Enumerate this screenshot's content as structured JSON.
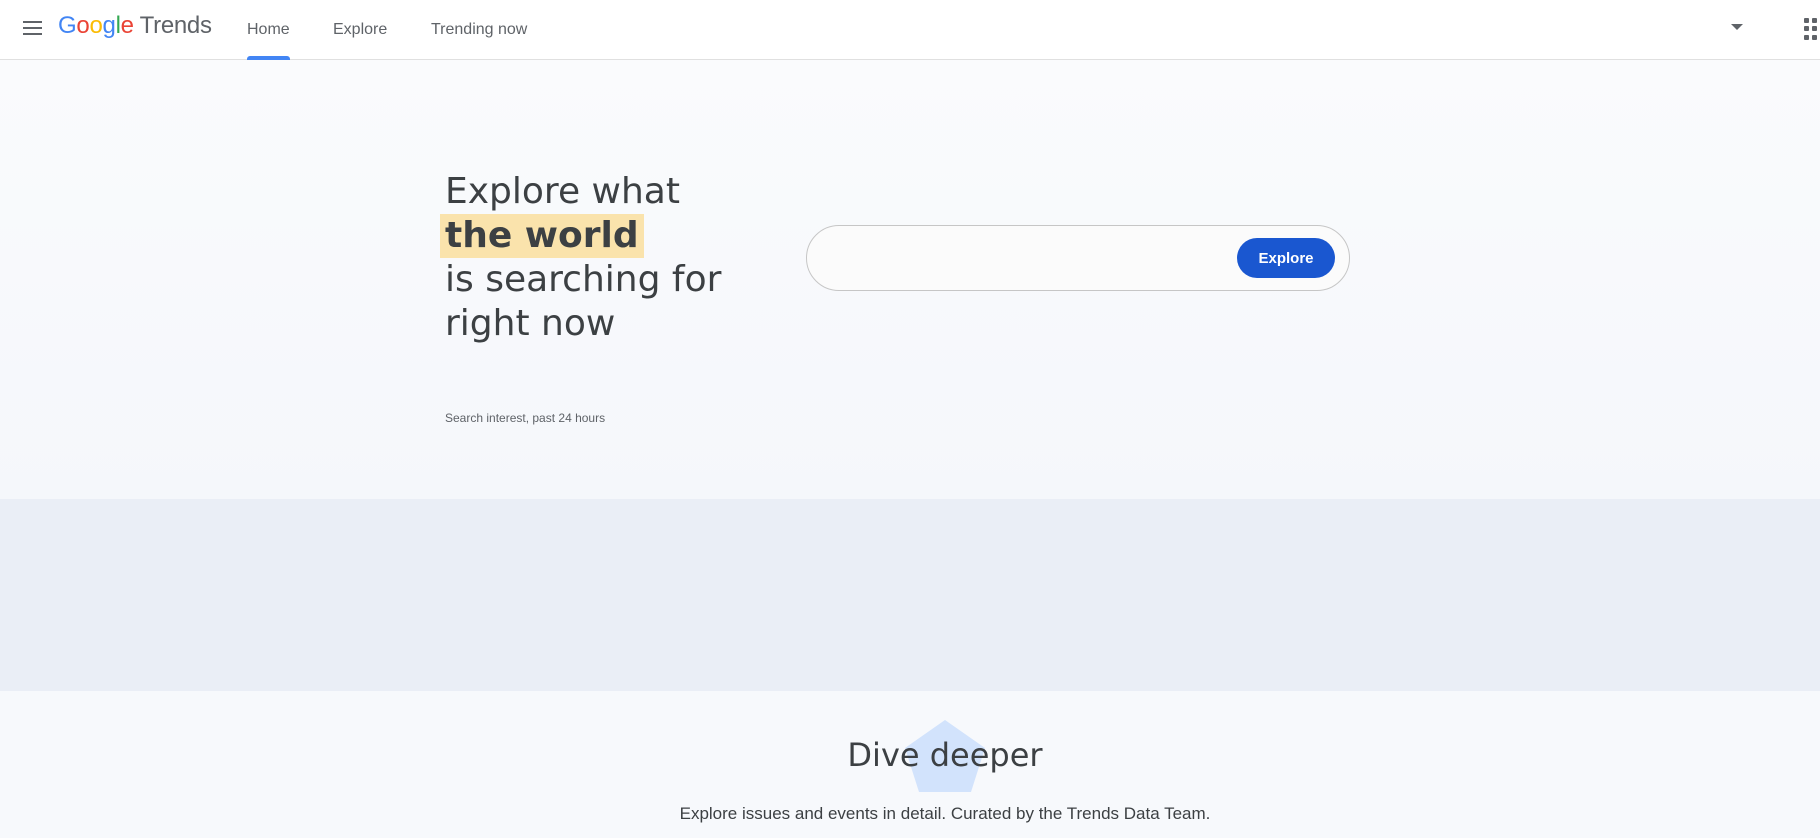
{
  "header": {
    "logo_word": "Google",
    "logo_product": "Trends",
    "tabs": [
      {
        "label": "Home",
        "active": true
      },
      {
        "label": "Explore",
        "active": false
      },
      {
        "label": "Trending now",
        "active": false
      }
    ],
    "icons": [
      "menu-icon",
      "dropdown-caret-icon",
      "apps-grid-icon"
    ]
  },
  "hero": {
    "line1": "Explore what",
    "highlight": "the world",
    "line3": "is searching for",
    "line4": "right now",
    "highlight_color": "#fae3ac"
  },
  "search": {
    "placeholder": "",
    "value": "",
    "button_label": "Explore",
    "button_color": "#1a57d0"
  },
  "interest": {
    "label": "Search interest, past 24 hours"
  },
  "dive": {
    "title": "Dive deeper",
    "subtitle": "Explore issues and events in detail. Curated by the Trends Data Team."
  },
  "colors": {
    "accent": "#4285f4",
    "band": "#eaeef6"
  }
}
